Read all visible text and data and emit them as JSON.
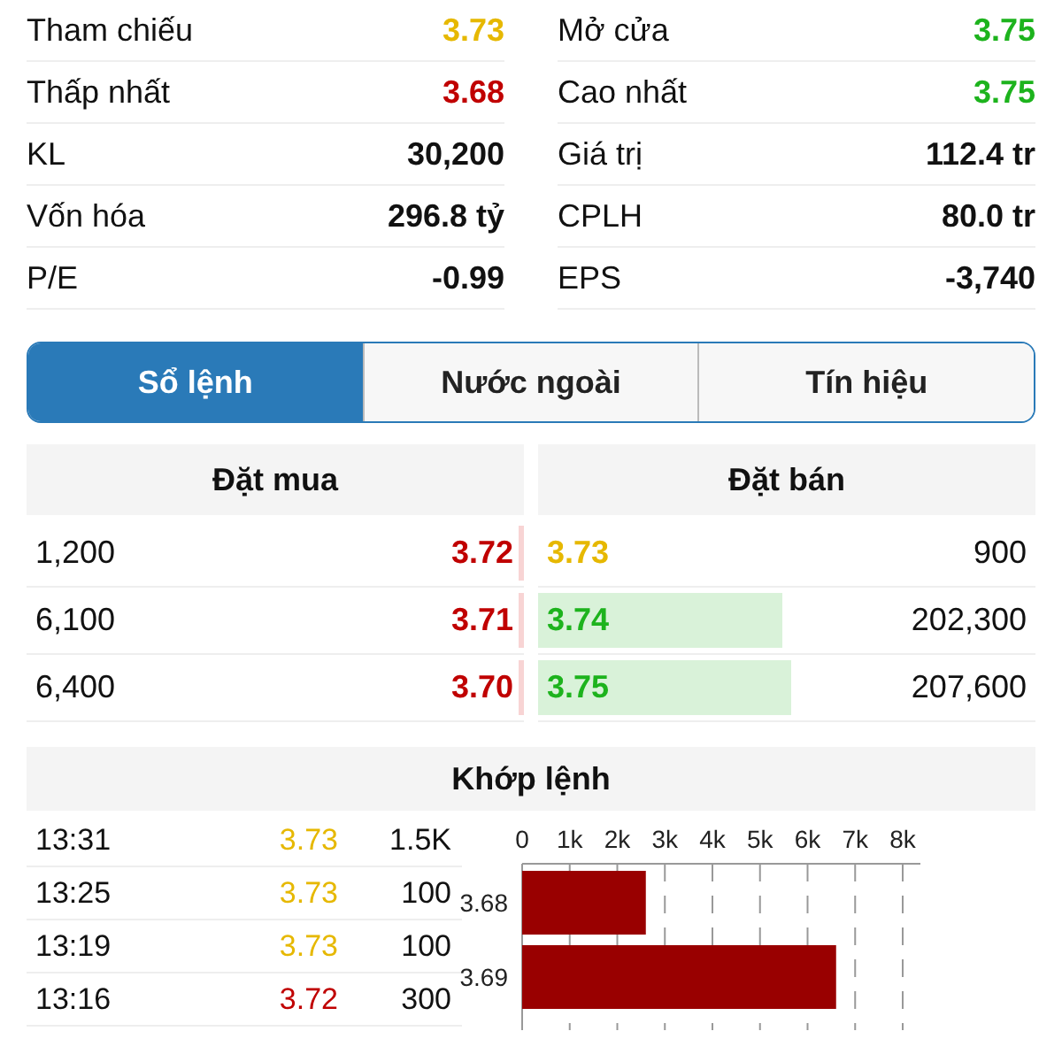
{
  "stats": [
    {
      "label": "Tham chiếu",
      "value": "3.73",
      "color": "#e6b800"
    },
    {
      "label": "Mở cửa",
      "value": "3.75",
      "color": "#1db31d"
    },
    {
      "label": "Thấp nhất",
      "value": "3.68",
      "color": "#c00000"
    },
    {
      "label": "Cao nhất",
      "value": "3.75",
      "color": "#1db31d"
    },
    {
      "label": "KL",
      "value": "30,200"
    },
    {
      "label": "Giá trị",
      "value": "112.4 tr"
    },
    {
      "label": "Vốn hóa",
      "value": "296.8 tỷ"
    },
    {
      "label": "CPLH",
      "value": "80.0 tr"
    },
    {
      "label": "P/E",
      "value": "-0.99"
    },
    {
      "label": "EPS",
      "value": "-3,740"
    }
  ],
  "tabs": [
    {
      "label": "Sổ lệnh",
      "selected": true
    },
    {
      "label": "Nước ngoài",
      "selected": false
    },
    {
      "label": "Tín hiệu",
      "selected": false
    }
  ],
  "order_book": {
    "bid_title": "Đặt mua",
    "ask_title": "Đặt bán",
    "rows": [
      {
        "bid": {
          "volume": "1,200",
          "price": "3.72",
          "color": "#c00000",
          "level": 0.01
        },
        "ask": {
          "price": "3.73",
          "color": "#e6b800",
          "volume": "900"
        }
      },
      {
        "bid": {
          "volume": "6,100",
          "price": "3.71",
          "color": "#c00000",
          "level": 0.01
        },
        "ask": {
          "price": "3.74",
          "color": "#1db31d",
          "level": 0.49,
          "volume": "202,300"
        }
      },
      {
        "bid": {
          "volume": "6,400",
          "price": "3.70",
          "color": "#c00000",
          "level": 0.01
        },
        "ask": {
          "price": "3.75",
          "color": "#1db31d",
          "level": 0.51,
          "volume": "207,600"
        }
      }
    ]
  },
  "matches": {
    "title": "Khớp lệnh",
    "rows": [
      {
        "time": "13:31",
        "price": "3.73",
        "color": "#e6b800",
        "volume": "1.5K"
      },
      {
        "time": "13:25",
        "price": "3.73",
        "color": "#e6b800",
        "volume": "100"
      },
      {
        "time": "13:19",
        "price": "3.73",
        "color": "#e6b800",
        "volume": "100"
      },
      {
        "time": "13:16",
        "price": "3.72",
        "color": "#c00000",
        "volume": "300"
      }
    ],
    "chart_data": {
      "type": "bar",
      "orientation": "horizontal",
      "grid": true,
      "categories": [
        "3.68",
        "3.69"
      ],
      "series": [
        {
          "color": "#990000",
          "values": [
            2600,
            6600
          ]
        }
      ],
      "xlim": [
        0,
        8000
      ],
      "xticks": [
        {
          "value": 0,
          "label": "0"
        },
        {
          "value": 1000,
          "label": "1k"
        },
        {
          "value": 2000,
          "label": "2k"
        },
        {
          "value": 3000,
          "label": "3k"
        },
        {
          "value": 4000,
          "label": "4k"
        },
        {
          "value": 5000,
          "label": "5k"
        },
        {
          "value": 6000,
          "label": "6k"
        },
        {
          "value": 7000,
          "label": "7k"
        },
        {
          "value": 8000,
          "label": "8k"
        }
      ]
    }
  }
}
